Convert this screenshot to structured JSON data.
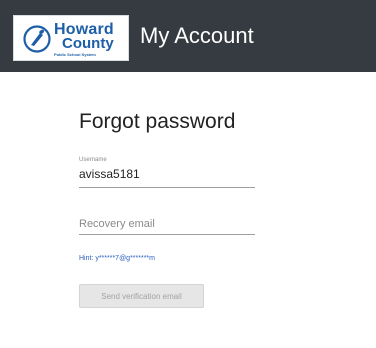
{
  "header": {
    "logo": {
      "line1": "Howard",
      "line2": "County",
      "tagline": "Public School System"
    },
    "title": "My Account",
    "colors": {
      "bar": "#353b41",
      "logo_text": "#1d5fa7"
    }
  },
  "form": {
    "heading": "Forgot password",
    "username": {
      "label": "Username",
      "value": "avissa5181"
    },
    "recovery_email": {
      "placeholder": "Recovery email",
      "value": ""
    },
    "hint": "Hint: y******7@g*******m",
    "send_button": {
      "label": "Send verification email",
      "enabled": false
    }
  },
  "icons": {
    "logo_emblem": "torch-emblem-icon"
  }
}
